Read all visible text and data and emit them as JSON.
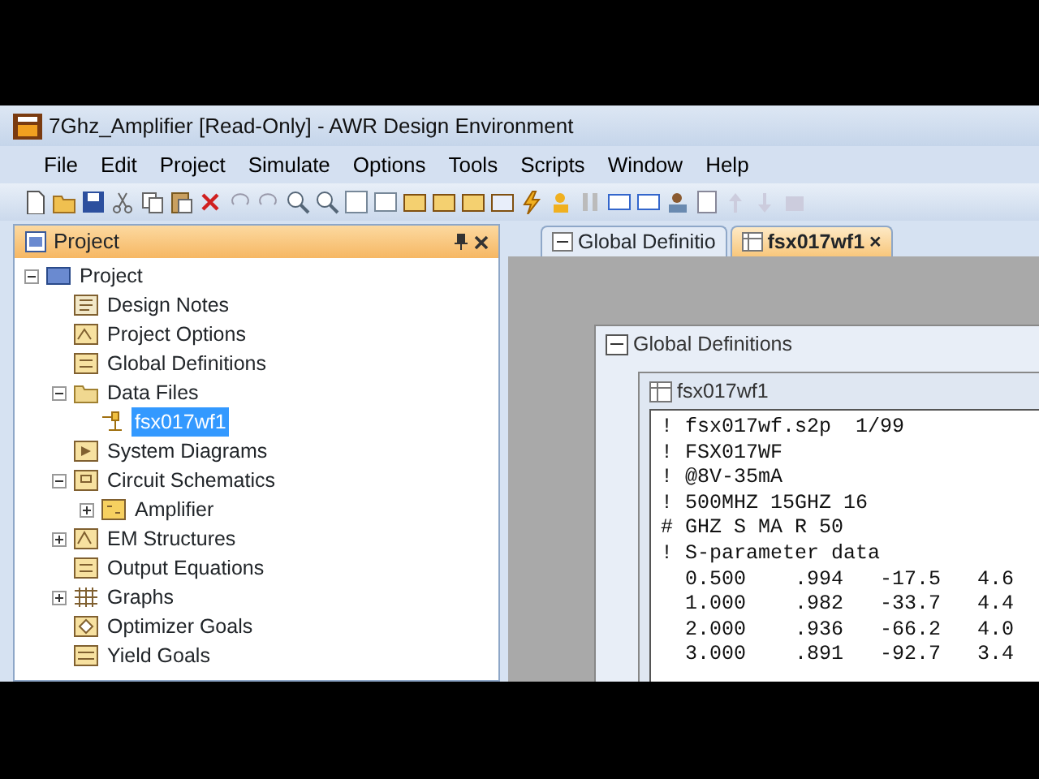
{
  "window": {
    "title": "7Ghz_Amplifier [Read-Only] - AWR Design Environment"
  },
  "menu": [
    "File",
    "Edit",
    "Project",
    "Simulate",
    "Options",
    "Tools",
    "Scripts",
    "Window",
    "Help"
  ],
  "project_panel": {
    "title": "Project",
    "tree": [
      {
        "label": "Project",
        "kind": "project",
        "expanded": true,
        "children": [
          {
            "label": "Design Notes",
            "kind": "notes"
          },
          {
            "label": "Project Options",
            "kind": "options"
          },
          {
            "label": "Global Definitions",
            "kind": "equation"
          },
          {
            "label": "Data Files",
            "kind": "folder",
            "expanded": true,
            "children": [
              {
                "label": "fsx017wf1",
                "kind": "data",
                "selected": true
              }
            ]
          },
          {
            "label": "System Diagrams",
            "kind": "system"
          },
          {
            "label": "Circuit Schematics",
            "kind": "schematic",
            "expanded": true,
            "children": [
              {
                "label": "Amplifier",
                "kind": "circuit",
                "expanded": false
              }
            ]
          },
          {
            "label": "EM Structures",
            "kind": "em",
            "expanded": false
          },
          {
            "label": "Output Equations",
            "kind": "equation"
          },
          {
            "label": "Graphs",
            "kind": "graph",
            "expanded": false
          },
          {
            "label": "Optimizer Goals",
            "kind": "optimizer"
          },
          {
            "label": "Yield Goals",
            "kind": "yield"
          }
        ]
      }
    ]
  },
  "tabs": [
    {
      "label": "Global Definitio",
      "selected": false
    },
    {
      "label": "fsx017wf1",
      "selected": true,
      "close": "×"
    }
  ],
  "windows": [
    {
      "title": "Global Definitions"
    },
    {
      "title": "fsx017wf1",
      "lines": [
        "! fsx017wf.s2p  1/99",
        "! FSX017WF",
        "! @8V-35mA",
        "! 500MHZ 15GHZ 16",
        "# GHZ S MA R 50",
        "! S-parameter data",
        "  0.500    .994   -17.5   4.6",
        "  1.000    .982   -33.7   4.4",
        "  2.000    .936   -66.2   4.0",
        "  3.000    .891   -92.7   3.4"
      ]
    }
  ]
}
